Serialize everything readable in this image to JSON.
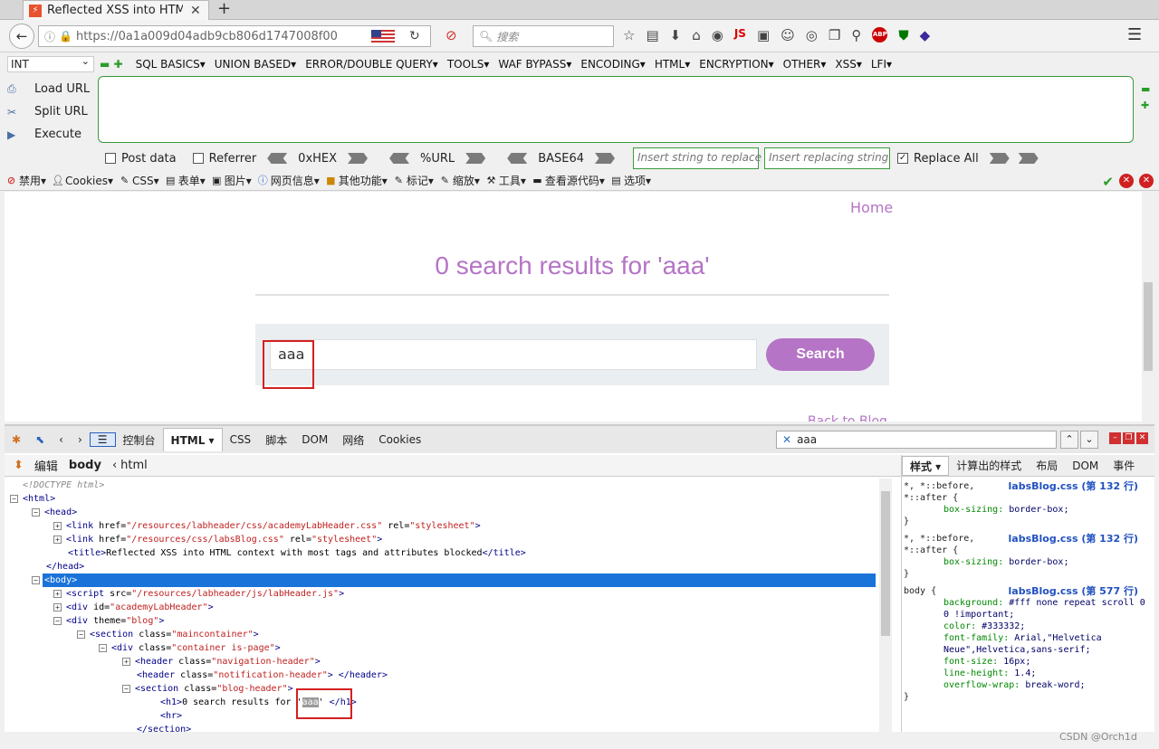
{
  "browser": {
    "tab_title": "Reflected XSS into HTM...",
    "tab_close": "✕",
    "url": "https://0a1a009d04adb9cb806d1747008f00",
    "search_placeholder": "搜索"
  },
  "hackbar": {
    "select_value": "INT",
    "menu": [
      "SQL BASICS▾",
      "UNION BASED▾",
      "ERROR/DOUBLE QUERY▾",
      "TOOLS▾",
      "WAF BYPASS▾",
      "ENCODING▾",
      "HTML▾",
      "ENCRYPTION▾",
      "OTHER▾",
      "XSS▾",
      "LFI▾"
    ],
    "load_url": "Load URL",
    "split_url": "Split URL",
    "execute": "Execute",
    "post_data": "Post data",
    "referrer": "Referrer",
    "hex": "0xHEX",
    "url_enc": "%URL",
    "base64": "BASE64",
    "replace_placeholder": "Insert string to replace",
    "replacing_placeholder": "Insert replacing string",
    "replace_all": "Replace All"
  },
  "webdev": {
    "items": [
      "禁用▾",
      "Cookies▾",
      "CSS▾",
      "表单▾",
      "图片▾",
      "网页信息▾",
      "其他功能▾",
      "标记▾",
      "缩放▾",
      "工具▾",
      "查看源代码▾",
      "选项▾"
    ]
  },
  "page": {
    "home": "Home",
    "title": "0 search results for 'aaa'",
    "search_value": "aaa",
    "search_button": "Search",
    "back_link": "Back to Blog"
  },
  "firebug": {
    "tabs": [
      "控制台",
      "HTML ▾",
      "CSS",
      "脚本",
      "DOM",
      "网络",
      "Cookies"
    ],
    "search_value": "aaa",
    "crumb_edit": "编辑",
    "crumb_body": "body",
    "crumb_html": "html",
    "side_tabs": [
      "样式 ▾",
      "计算出的样式",
      "布局",
      "DOM",
      "事件"
    ],
    "lines": {
      "doctype": "<!DOCTYPE html>",
      "html_open": "<html>",
      "head_open": "<head>",
      "link1_href": "/resources/labheader/css/academyLabHeader.css",
      "link2_href": "/resources/css/labsBlog.css",
      "rel": "stylesheet",
      "title_text": "Reflected XSS into HTML context with most tags and attributes blocked",
      "head_close": "</head>",
      "body_open": "<body>",
      "script_src": "/resources/labheader/js/labHeader.js",
      "div_id": "academyLabHeader",
      "div_theme": "blog",
      "section_class": "maincontainer",
      "div_class": "container is-page",
      "header1_class": "navigation-header",
      "header2_class": "notification-header",
      "section2_class": "blog-header",
      "h1_text": "0 search results for '",
      "h1_hl": "aaa",
      "h1_end": "'",
      "hr": "<hr>",
      "section_close": "</section>"
    },
    "css_rules": [
      {
        "selector": "*, *::before,\n*::after {",
        "source": "labsBlog.css (第 132 行)",
        "props": [
          [
            "box-sizing",
            "border-box;"
          ]
        ]
      },
      {
        "selector": "*, *::before,\n*::after {",
        "source": "labsBlog.css (第 132 行)",
        "props": [
          [
            "box-sizing",
            "border-box;"
          ]
        ]
      },
      {
        "selector": "body {",
        "source": "labsBlog.css (第 577 行)",
        "props": [
          [
            "background",
            "#fff none repeat scroll 0 0 !important;"
          ],
          [
            "color",
            "#333332;"
          ],
          [
            "font-family",
            "Arial,\"Helvetica Neue\",Helvetica,sans-serif;"
          ],
          [
            "font-size",
            "16px;"
          ],
          [
            "line-height",
            "1.4;"
          ],
          [
            "overflow-wrap",
            "break-word;"
          ]
        ]
      }
    ]
  },
  "watermark": "CSDN @Orch1d"
}
